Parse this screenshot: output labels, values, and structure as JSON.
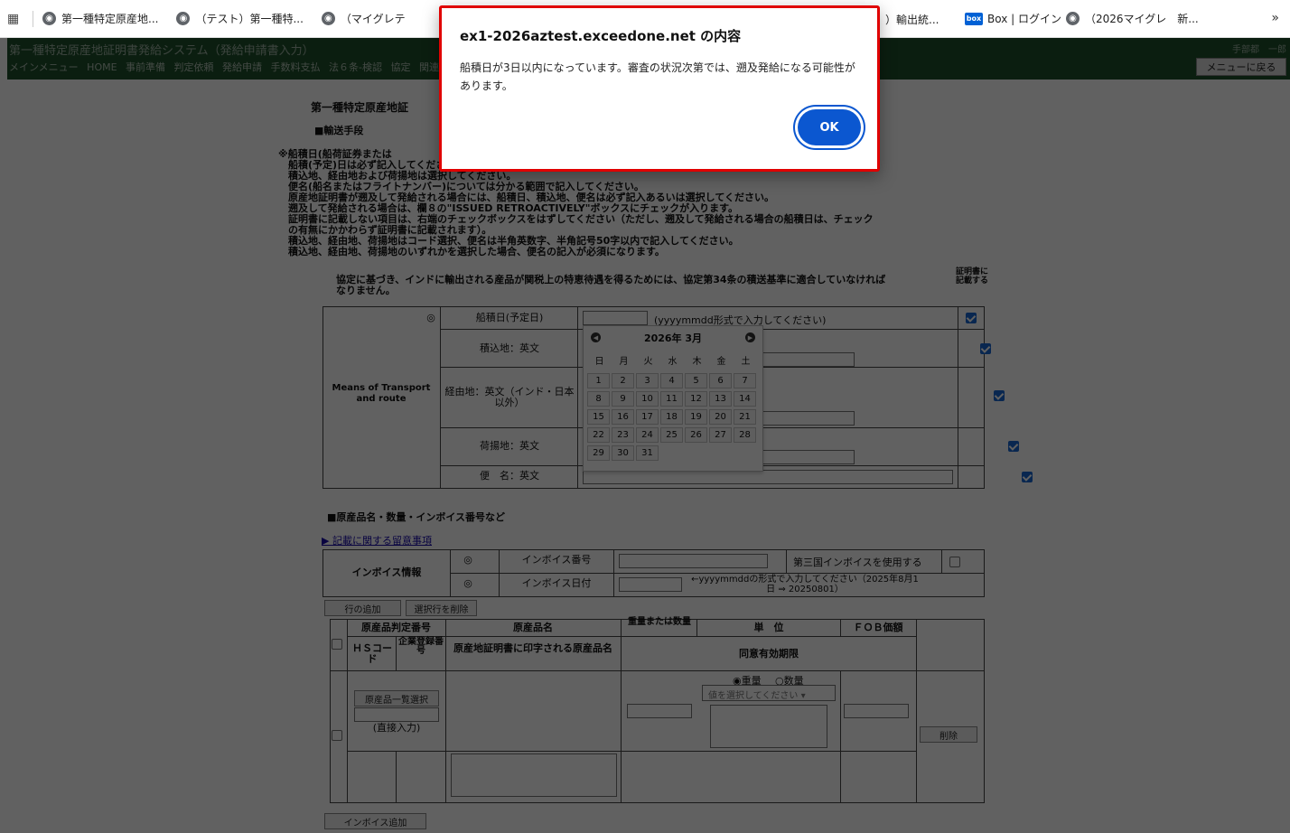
{
  "bookmarks": {
    "items": [
      {
        "label": "第一種特定原産地..."
      },
      {
        "label": "（テスト）第一種特..."
      },
      {
        "label": "（マイグレテ"
      },
      {
        "label": "）輸出統..."
      },
      {
        "label": "Box | ログイン"
      },
      {
        "label": "（2026マイグレ　新..."
      }
    ],
    "more": "»",
    "box_logo": "box"
  },
  "app": {
    "title": "第一種特定原産地証明書発給システム（発給申請書入力）",
    "nav": [
      "メインメニュー",
      "HOME",
      "事前準備",
      "判定依頼",
      "発給申請",
      "手数料支払",
      "法６条-検認",
      "協定",
      "関連"
    ],
    "user": "手部都　一郎",
    "menu_back": "メニューに戻る"
  },
  "form": {
    "page_heading": "第一種特定原産地証",
    "transport_heading": "■輸送手段",
    "notes": [
      "※船積日(船荷証券または",
      "　船積(予定)日は必ず記入してください。",
      "　積込地、経由地および荷揚地は選択してください。",
      "　便名(船名またはフライトナンバー)については分かる範囲で記入してください。",
      "　原産地証明書が遡及して発給される場合には、船積日、積込地、便名は必ず記入あるいは選択してください。",
      "　遡及して発給される場合は、欄８の\"ISSUED RETROACTIVELY\"ボックスにチェックが入ります。",
      "　証明書に記載しない項目は、右端のチェックボックスをはずしてください（ただし、遡及して発給される場合の船積日は、チェック",
      "　の有無にかかわらず証明書に記載されます）。",
      "　積込地、経由地、荷揚地はコード選択、便名は半角英数字、半角記号50字以内で記入してください。",
      "　積込地、経由地、荷揚地のいずれかを選択した場合、便名の記入が必須になります。"
    ],
    "agreement_note": "協定に基づき、インドに輸出される産品が関税上の特恵待遇を得るためには、協定第34条の積送基準に適合していなければなりません。",
    "cert_col_label": "証明書に記載する",
    "means_label": "Means of Transport and route",
    "required_mark": "◎",
    "rows": {
      "ship_date": "船積日(予定日)",
      "ship_date_hint": "(yyyymmdd形式で入力してください)",
      "loading": "積込地：英文",
      "via": "経由地：英文（インド・日本以外）",
      "unloading": "荷揚地：英文",
      "flight": "便　名：英文"
    },
    "goods_heading": "■原産品名・数量・インボイス番号など",
    "notes_link": "▶ 記載に関する留意事項",
    "invoice_info": "インボイス情報",
    "invoice_no": "インボイス番号",
    "third_party": "第三国インボイスを使用する",
    "invoice_date": "インボイス日付",
    "invoice_date_hint": "←yyyymmddの形式で入力してください（2025年8月1日 ⇒ 20250801）",
    "add_row": "行の追加",
    "delete_selected": "選択行を削除",
    "col_judgment_no": "原産品判定番号",
    "col_product": "原産品名",
    "col_weight": "重量または数量",
    "col_unit": "単　位",
    "col_fob": "ＦＯＢ価額",
    "col_hs": "ＨＳコード",
    "col_company": "企業登録番号",
    "col_print_name": "原産地証明書に印字される原産品名",
    "col_consent": "同意有効期限",
    "radio_weight": "◉重量",
    "radio_qty": "○数量",
    "select_placeholder": "値を選択してください",
    "list_select": "原産品一覧選択",
    "direct_input": "(直接入力)",
    "delete": "削除",
    "add_invoice": "インボイス追加"
  },
  "calendar": {
    "month": "2026年 3月",
    "prev": "◀",
    "next": "▶",
    "dow": [
      "日",
      "月",
      "火",
      "水",
      "木",
      "金",
      "土"
    ],
    "days": [
      "1",
      "2",
      "3",
      "4",
      "5",
      "6",
      "7",
      "8",
      "9",
      "10",
      "11",
      "12",
      "13",
      "14",
      "15",
      "16",
      "17",
      "18",
      "19",
      "20",
      "21",
      "22",
      "23",
      "24",
      "25",
      "26",
      "27",
      "28",
      "29",
      "30",
      "31"
    ]
  },
  "dialog": {
    "title": "ex1-2026aztest.exceedone.net の内容",
    "message": "船積日が3日以内になっています。審査の状況次第では、遡及発給になる可能性があります。",
    "ok": "OK"
  },
  "colors": {
    "header_green": "#1f4f2c",
    "dialog_border": "#e00000",
    "ok_button": "#0b57d0",
    "checkbox": "#1967d2"
  }
}
